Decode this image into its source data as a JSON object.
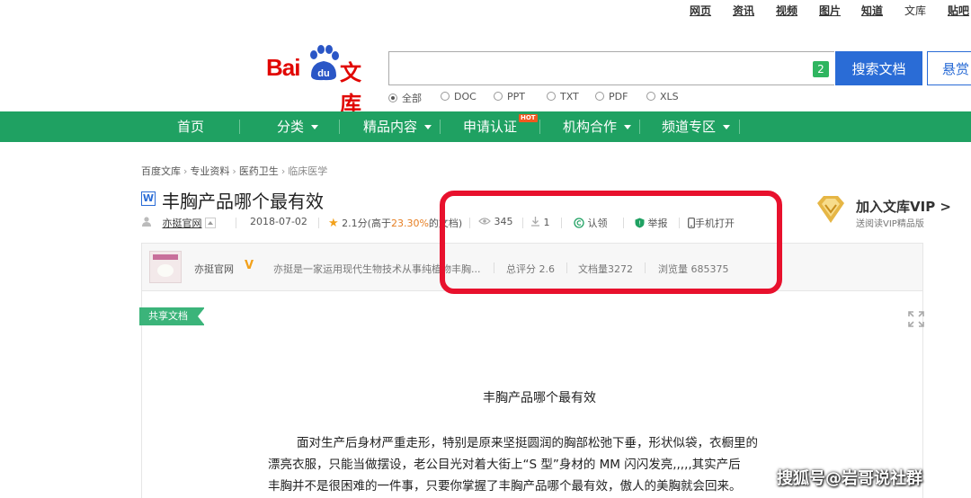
{
  "top_links": [
    "网页",
    "资讯",
    "视频",
    "图片",
    "知道",
    "文库",
    "贴吧"
  ],
  "logo": {
    "bai": "Bai",
    "du": "du",
    "wenku": "文库"
  },
  "search": {
    "value": "",
    "count": "2",
    "button": "搜索文档",
    "button2": "悬赏"
  },
  "file_types": [
    {
      "label": "全部",
      "selected": true
    },
    {
      "label": "DOC",
      "selected": false
    },
    {
      "label": "PPT",
      "selected": false
    },
    {
      "label": "TXT",
      "selected": false
    },
    {
      "label": "PDF",
      "selected": false
    },
    {
      "label": "XLS",
      "selected": false
    }
  ],
  "nav": {
    "items": [
      "首页",
      "分类",
      "精品内容",
      "申请认证",
      "机构合作",
      "频道专区"
    ],
    "hot_badge": "HOT"
  },
  "breadcrumb": [
    "百度文库",
    "专业资料",
    "医药卫生",
    "临床医学"
  ],
  "doc": {
    "type_icon": "W",
    "title": "丰胸产品哪个最有效",
    "uploader": "亦挺官网",
    "date": "2018-07-02",
    "rating": "2.1分(高于",
    "rating_pct": "23.30%",
    "rating_tail": "的文档)",
    "views": "345",
    "downloads": "1",
    "claim": "认领",
    "report": "举报",
    "mobile": "手机打开"
  },
  "vip": {
    "title": "加入文库VIP >",
    "sub": "送阅读VIP精品版"
  },
  "author": {
    "name": "亦挺官网",
    "v_mark": "V",
    "desc": "亦挺是一家运用现代生物技术从事纯植物丰胸...",
    "total_score": "总评分 2.6",
    "doc_count": "文档量3272",
    "view_count": "浏览量 685375"
  },
  "share_tag": "共享文档",
  "content": {
    "heading": "丰胸产品哪个最有效",
    "lines": [
      "面对生产后身材严重走形，特别是原来坚挺圆润的胸部松弛下垂，形状似袋，衣橱里的",
      "漂亮衣服，只能当做摆设，老公目光对着大街上“S 型”身材的 MM 闪闪发亮,,,,,其实产后",
      "丰胸并不是很困难的一件事，只要你掌握了丰胸产品哪个最有效，傲人的美胸就会回来。"
    ]
  },
  "watermark": "搜狐号@岩哥说社群",
  "colors": {
    "nav_green": "#1fa162",
    "brand_red": "#e10602",
    "search_blue": "#2a6cd6",
    "highlight_red": "#e8112d"
  }
}
